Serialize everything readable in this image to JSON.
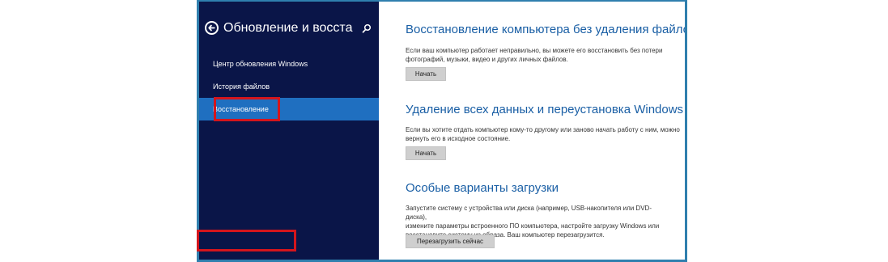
{
  "sidebar": {
    "title": "Обновление и восстан...",
    "back_icon": "back-arrow-icon",
    "search_icon": "search-icon",
    "items": [
      {
        "label": "Центр обновления Windows"
      },
      {
        "label": "История файлов"
      },
      {
        "label": "Восстановление",
        "active": true
      }
    ]
  },
  "sections": [
    {
      "title": "Восстановление компьютера без удаления файлов",
      "desc_lines": [
        "Если ваш компьютер работает неправильно, вы можете его восстановить без потери",
        "фотографий, музыки, видео и других личных файлов."
      ],
      "button": "Начать"
    },
    {
      "title": "Удаление всех данных и переустановка Windows",
      "desc_lines": [
        "Если вы хотите отдать компьютер кому-то другому или заново начать работу с ним, можно",
        "вернуть его в исходное состояние."
      ],
      "button": "Начать"
    },
    {
      "title": "Особые варианты загрузки",
      "desc_lines": [
        "Запустите систему с устройства или диска (например, USB-накопителя или DVD-диска),",
        "измените параметры встроенного ПО компьютера, настройте загрузку Windows или",
        "восстановите систему из образа. Ваш компьютер перезагрузится."
      ],
      "button": "Перезагрузить сейчас"
    }
  ],
  "colors": {
    "sidebar_bg": "#0a1548",
    "active_item": "#1f6fc0",
    "section_title": "#1a5fa5",
    "highlight_box": "#d4151c",
    "frame_border": "#2f7fae"
  }
}
